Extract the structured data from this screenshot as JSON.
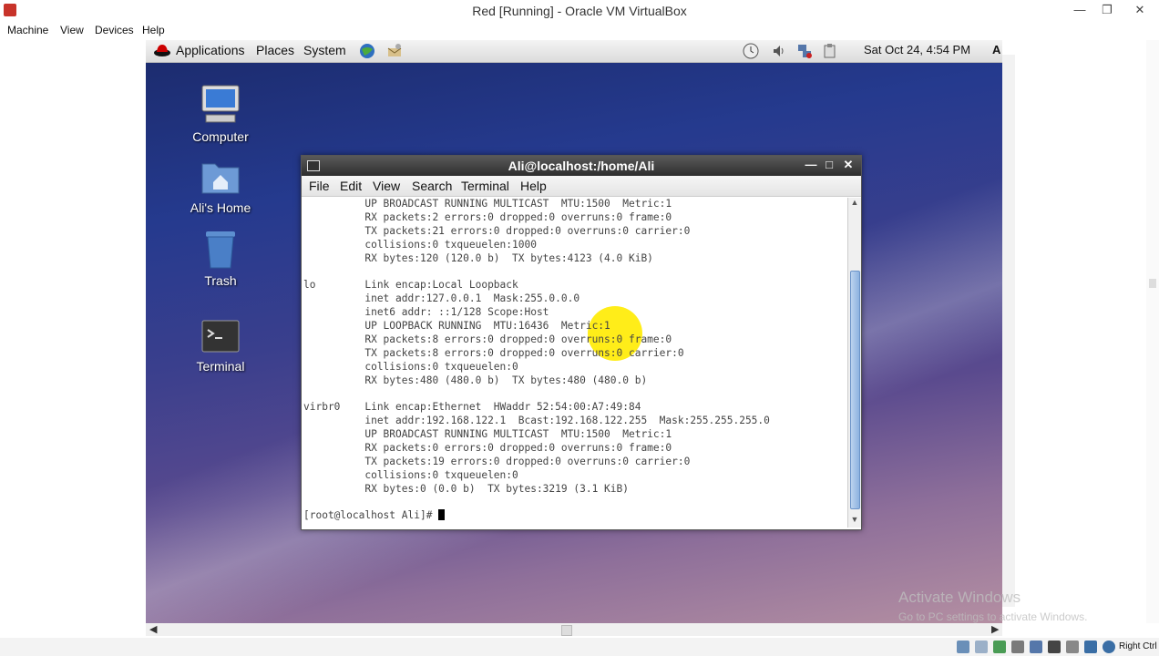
{
  "host": {
    "title": "Red [Running] - Oracle VM VirtualBox",
    "menu": [
      "Machine",
      "View",
      "Devices",
      "Help"
    ],
    "host_key": "Right Ctrl"
  },
  "guest_panel": {
    "menus": [
      "Applications",
      "Places",
      "System"
    ],
    "clock": "Sat Oct 24,  4:54 PM",
    "keyboard": "A"
  },
  "desktop_icons": [
    {
      "label": "Computer",
      "icon": "computer-icon"
    },
    {
      "label": "Ali's Home",
      "icon": "home-folder-icon"
    },
    {
      "label": "Trash",
      "icon": "trash-icon"
    },
    {
      "label": "Terminal",
      "icon": "terminal-icon"
    }
  ],
  "terminal": {
    "title": "Ali@localhost:/home/Ali",
    "menu": [
      "File",
      "Edit",
      "View",
      "Search",
      "Terminal",
      "Help"
    ],
    "lines": [
      "          UP BROADCAST RUNNING MULTICAST  MTU:1500  Metric:1",
      "          RX packets:2 errors:0 dropped:0 overruns:0 frame:0",
      "          TX packets:21 errors:0 dropped:0 overruns:0 carrier:0",
      "          collisions:0 txqueuelen:1000",
      "          RX bytes:120 (120.0 b)  TX bytes:4123 (4.0 KiB)",
      "",
      "lo        Link encap:Local Loopback",
      "          inet addr:127.0.0.1  Mask:255.0.0.0",
      "          inet6 addr: ::1/128 Scope:Host",
      "          UP LOOPBACK RUNNING  MTU:16436  Metric:1",
      "          RX packets:8 errors:0 dropped:0 overruns:0 frame:0",
      "          TX packets:8 errors:0 dropped:0 overruns:0 carrier:0",
      "          collisions:0 txqueuelen:0",
      "          RX bytes:480 (480.0 b)  TX bytes:480 (480.0 b)",
      "",
      "virbr0    Link encap:Ethernet  HWaddr 52:54:00:A7:49:84",
      "          inet addr:192.168.122.1  Bcast:192.168.122.255  Mask:255.255.255.0",
      "          UP BROADCAST RUNNING MULTICAST  MTU:1500  Metric:1",
      "          RX packets:0 errors:0 dropped:0 overruns:0 frame:0",
      "          TX packets:19 errors:0 dropped:0 overruns:0 carrier:0",
      "          collisions:0 txqueuelen:0",
      "          RX bytes:0 (0.0 b)  TX bytes:3219 (3.1 KiB)",
      ""
    ],
    "prompt": "[root@localhost Ali]# "
  },
  "watermark": {
    "line1": "Activate Windows",
    "line2": "Go to PC settings to activate Windows."
  }
}
